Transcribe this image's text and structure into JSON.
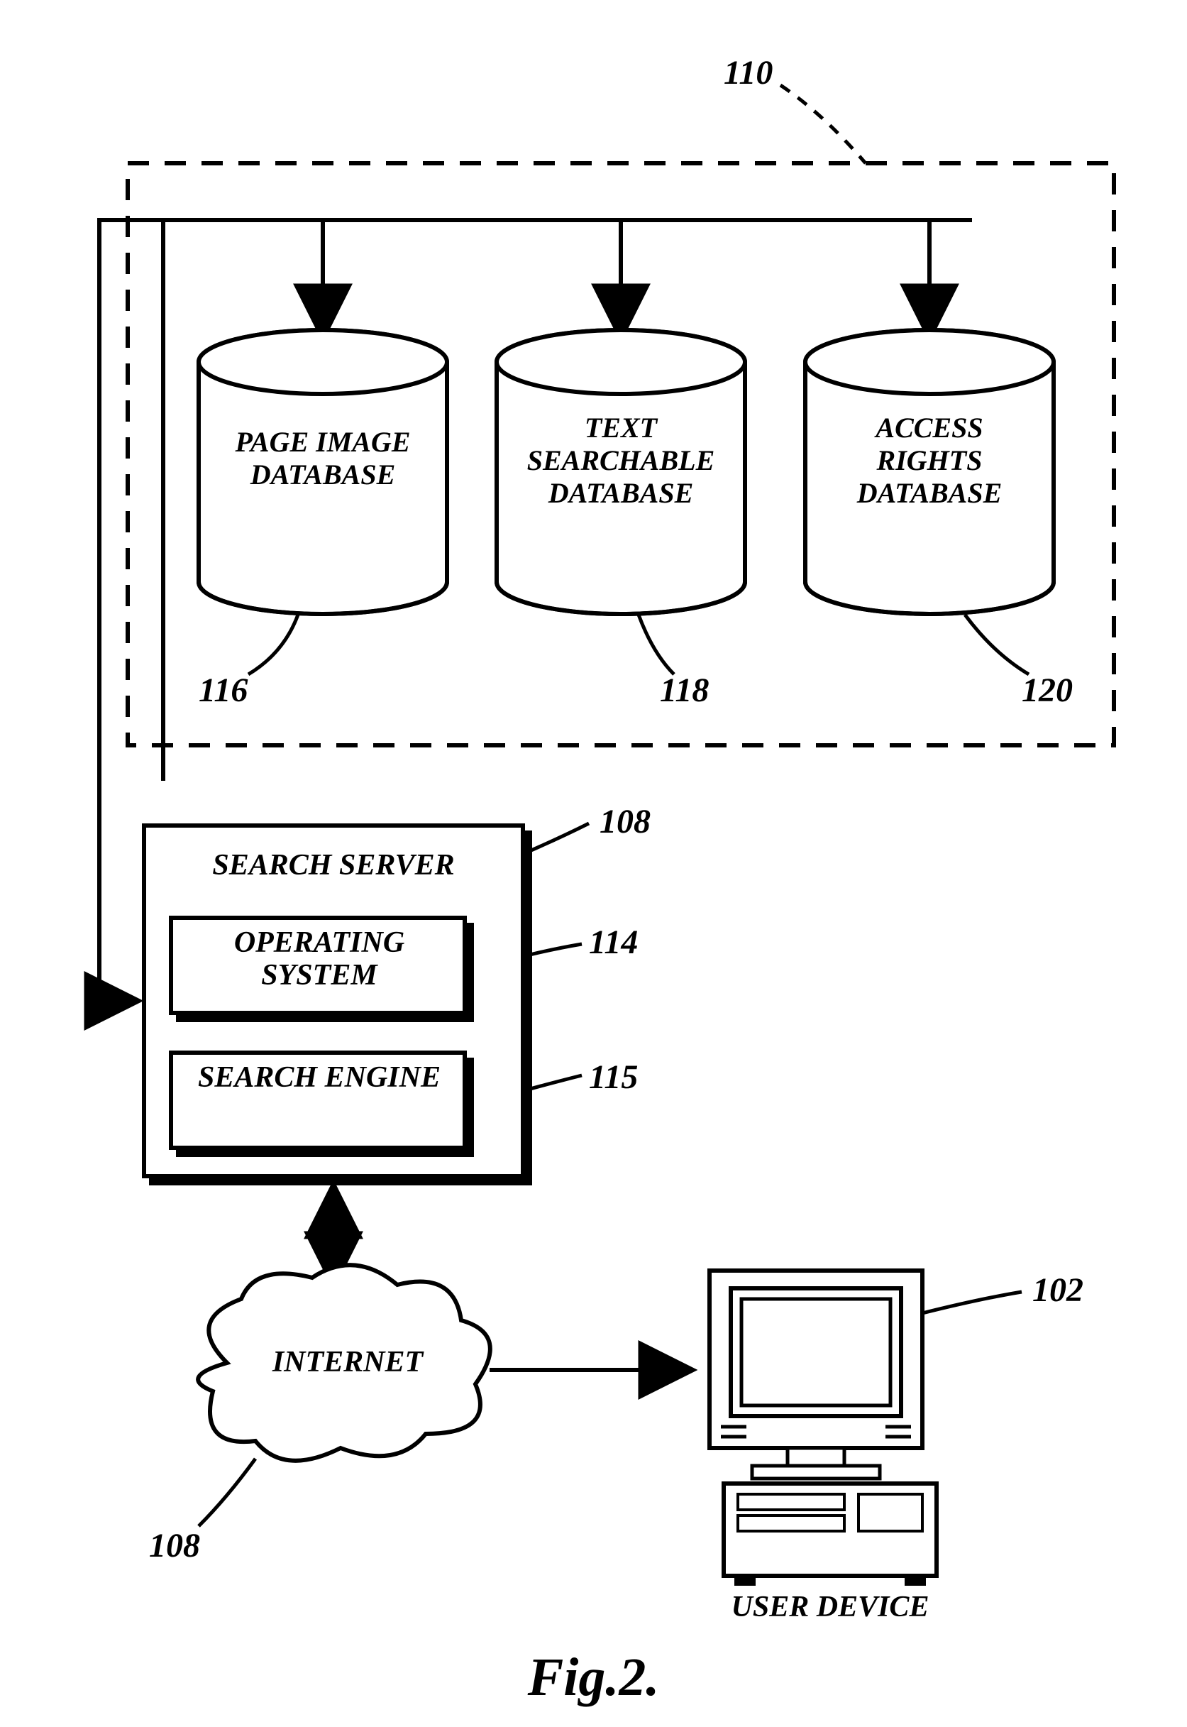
{
  "refs": {
    "r110": "110",
    "r116": "116",
    "r118": "118",
    "r120": "120",
    "r108a": "108",
    "r114": "114",
    "r115": "115",
    "r108b": "108",
    "r102": "102"
  },
  "db": {
    "page_image": "PAGE IMAGE DATABASE",
    "text_searchable": "TEXT SEARCHABLE DATABASE",
    "access_rights": "ACCESS RIGHTS DATABASE"
  },
  "server": {
    "title": "SEARCH SERVER",
    "os": "OPERATING SYSTEM",
    "engine": "SEARCH ENGINE"
  },
  "net": {
    "internet": "INTERNET",
    "user_device": "USER DEVICE"
  },
  "figure": "Fig.2."
}
